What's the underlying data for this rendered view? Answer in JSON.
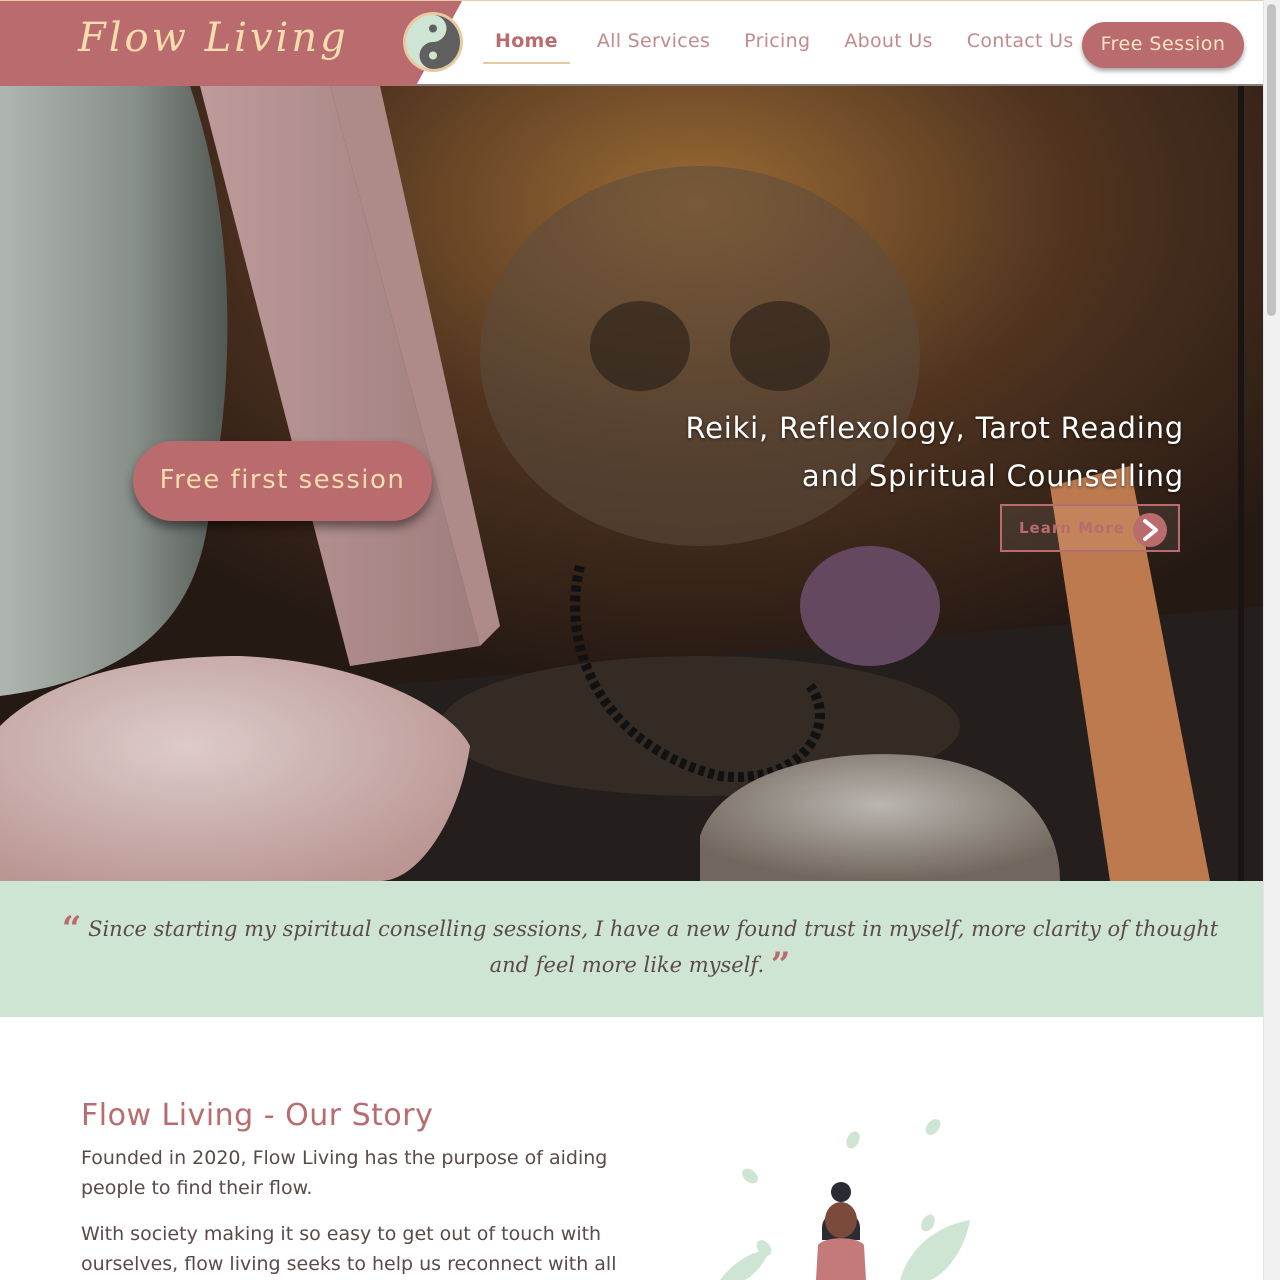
{
  "header": {
    "brand": "Flow Living",
    "nav": [
      "Home",
      "All Services",
      "Pricing",
      "About Us",
      "Contact Us"
    ],
    "active_nav": "Home",
    "cta": "Free Session"
  },
  "hero": {
    "cta": "Free first session",
    "heading_line1": "Reiki, Reflexology, Tarot Reading",
    "heading_line2": "and Spiritual Counselling",
    "learn_more": "Learn More"
  },
  "testimonial": {
    "open_quote": "“",
    "close_quote": "”",
    "text": "Since starting my spiritual conselling sessions, I have a new found trust in myself, more clarity of thought and feel more like myself."
  },
  "story": {
    "title": "Flow Living - Our Story",
    "paragraph1": "Founded in 2020, Flow Living has the purpose of aiding people to find their flow.",
    "paragraph2": "With society making it so easy to get out of touch with ourselves, flow living seeks to help us reconnect with all"
  },
  "colors": {
    "brand": "#b96b6d",
    "cream": "#f7dcae",
    "mint": "#cfe5d3",
    "text": "#5a4a48"
  },
  "icons": [
    "yin-yang-icon",
    "arrow-right-icon",
    "quote-open-icon",
    "quote-close-icon"
  ]
}
